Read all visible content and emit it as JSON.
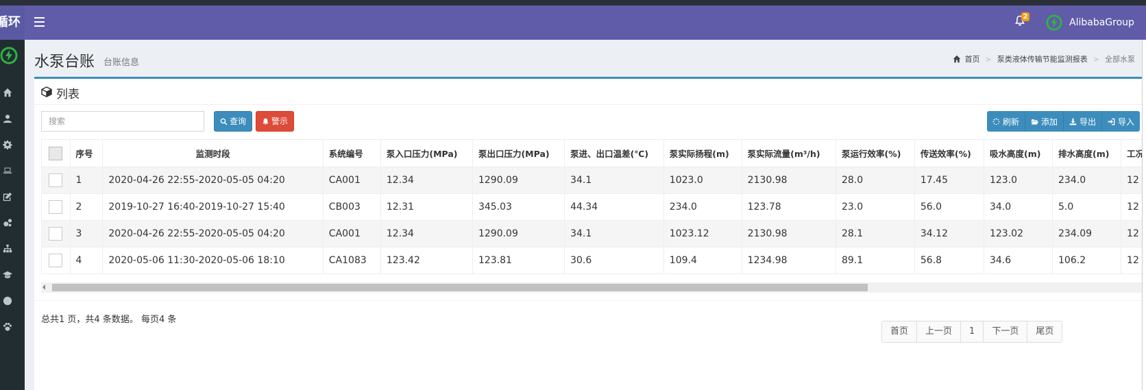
{
  "app": {
    "brand_text": "循环",
    "user_name": "AlibabaGroup",
    "notification_count": "2"
  },
  "sidebar": {
    "icons": [
      "home-icon",
      "user-icon",
      "gear-icon",
      "laptop-icon",
      "edit-icon",
      "gears-icon",
      "sitemap-icon",
      "graduation-cap-icon",
      "globe-icon",
      "paw-icon"
    ]
  },
  "page": {
    "title": "水泵台账",
    "subtitle": "台账信息"
  },
  "breadcrumb": {
    "home": "首页",
    "middle": "泵类液体传输节能监测报表",
    "current": "全部水泵"
  },
  "box": {
    "title": "列表"
  },
  "toolbar": {
    "search_placeholder": "搜索",
    "query_label": "查询",
    "alarm_label": "警示",
    "refresh_label": "刷新",
    "add_label": "添加",
    "export_label": "导出",
    "import_label": "导入"
  },
  "table": {
    "columns": [
      "序号",
      "监测时段",
      "系统编号",
      "泵入口压力(MPa)",
      "泵出口压力(MPa)",
      "泵进、出口温差(℃)",
      "泵实际扬程(m)",
      "泵实际流量(m³/h)",
      "泵运行效率(%)",
      "传送效率(%)",
      "吸水高度(m)",
      "排水高度(m)",
      "工况"
    ],
    "rows": [
      [
        "1",
        "2020-04-26 22:55-2020-05-05 04:20",
        "CA001",
        "12.34",
        "1290.09",
        "34.1",
        "1023.0",
        "2130.98",
        "28.0",
        "17.45",
        "123.0",
        "234.0",
        "12"
      ],
      [
        "2",
        "2019-10-27 16:40-2019-10-27 15:40",
        "CB003",
        "12.31",
        "345.03",
        "44.34",
        "234.0",
        "123.78",
        "23.0",
        "56.0",
        "34.0",
        "5.0",
        "12"
      ],
      [
        "3",
        "2020-04-26 22:55-2020-05-05 04:20",
        "CA001",
        "12.34",
        "1290.09",
        "34.1",
        "1023.12",
        "2130.98",
        "28.1",
        "34.12",
        "123.02",
        "234.09",
        "12"
      ],
      [
        "4",
        "2020-05-06 11:30-2020-05-06 18:10",
        "CA1083",
        "123.42",
        "123.81",
        "30.6",
        "109.4",
        "1234.98",
        "89.1",
        "56.8",
        "34.6",
        "106.2",
        "12"
      ]
    ]
  },
  "footer": {
    "summary": "总共1 页，共4 条数据。 每页4 条"
  },
  "pagination": {
    "first": "首页",
    "prev": "上一页",
    "current": "1",
    "next": "下一页",
    "last": "尾页"
  },
  "colors": {
    "header": "#605ca8",
    "sidebar": "#222d32",
    "primary": "#3c8dbc",
    "danger": "#dd4b39",
    "badge": "#f39c12"
  }
}
